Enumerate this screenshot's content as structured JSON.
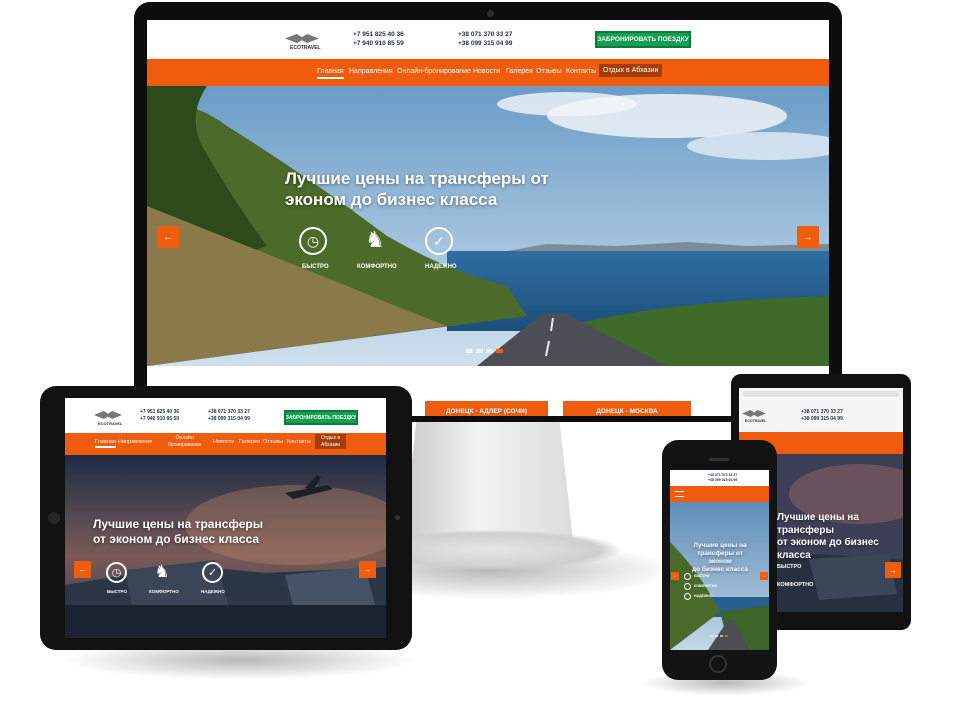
{
  "logo": "ECOTRAVEL",
  "phones_a": [
    "+7 951 825 40 36",
    "+7 940 910 85 59"
  ],
  "phones_b": [
    "+38 071 370 33 27",
    "+38 099 315 04 99"
  ],
  "cta": "Забронировать поездку",
  "nav": [
    "Главная",
    "Направления",
    "Онлайн-бронирование",
    "Новости",
    "Галерея",
    "Отзывы",
    "Контакты",
    "Отдых в Абхазии"
  ],
  "tablet_nav_online": [
    "Онлайн",
    "бронирование"
  ],
  "tablet_nav_abkhazia": [
    "Отдых в",
    "Абхазии"
  ],
  "hero_title": [
    "Лучшие цены на трансферы от",
    "эконом до бизнес класса"
  ],
  "hero_title_tablet": [
    "Лучшие цены на трансферы",
    "от эконом до бизнес класса"
  ],
  "hero_title_phone": [
    "Лучшие цены на",
    "трансферы от эконом",
    "до бизнес класса"
  ],
  "features": [
    "Быстро",
    "Комфортно",
    "Надежно"
  ],
  "routes": [
    "Донецк - Адлер (Сочи)",
    "Донецк - Москва"
  ],
  "arrow_left": "←",
  "arrow_right": "→",
  "slider": {
    "count": 4,
    "active": 3
  },
  "colors": {
    "brand_orange": "#ef5c0e",
    "cta_green": "#14a050",
    "nav_dark": "#a33e08"
  }
}
